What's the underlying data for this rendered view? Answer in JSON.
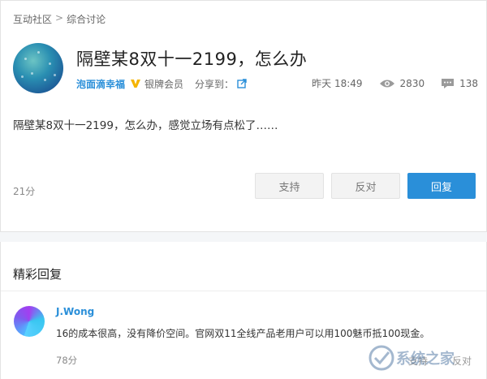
{
  "breadcrumb": {
    "items": [
      "互动社区",
      "综合讨论"
    ],
    "separator": ">"
  },
  "post": {
    "title": "隔壁某8双十一2199，怎么办",
    "author": "泡面滴幸福",
    "level": "银牌会员",
    "share_label": "分享到：",
    "time": "昨天 18:49",
    "views": "2830",
    "comments": "138",
    "content": "隔壁某8双十一2199，怎么办，感觉立场有点松了……",
    "score": "21分",
    "buttons": {
      "support": "支持",
      "oppose": "反对",
      "reply": "回复"
    }
  },
  "replies_section": {
    "title": "精彩回复",
    "items": [
      {
        "name": "J.Wong",
        "text": "16的成本很高，没有降价空间。官网双11全线产品老用户可以用100魅币抵100现金。",
        "score": "78分",
        "support": "支持",
        "oppose": "反对"
      }
    ]
  },
  "colors": {
    "accent": "#2a8fd9",
    "badge": "#f5b400"
  },
  "watermark": {
    "text": "系统之家"
  }
}
